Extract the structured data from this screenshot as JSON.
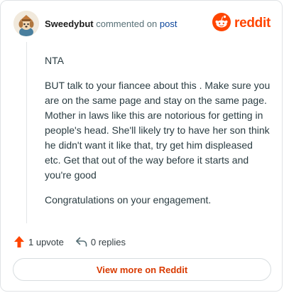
{
  "header": {
    "username": "Sweedybut",
    "action_text": "commented on",
    "post_link": "post",
    "logo_text": "reddit"
  },
  "comment": {
    "paragraphs": [
      "NTA",
      "BUT talk to your fiancee about this . Make sure you are on the same page and stay on the same page. Mother in laws like this are notorious for getting in people's head. She'll likely try to have her son think he didn't want it like that, try get him displeased etc. Get that out of the way before it starts and you're good",
      "Congratulations on your engagement."
    ]
  },
  "actions": {
    "upvotes": "1 upvote",
    "replies": "0 replies"
  },
  "footer": {
    "view_more_label": "View more on Reddit"
  },
  "colors": {
    "brand": "#ff4500",
    "link": "#0a449b",
    "cta_text": "#d93a00"
  },
  "icons": {
    "avatar": "avatar-icon",
    "logo": "reddit-logo-icon",
    "upvote": "upvote-arrow-icon",
    "reply": "reply-arrow-icon"
  }
}
